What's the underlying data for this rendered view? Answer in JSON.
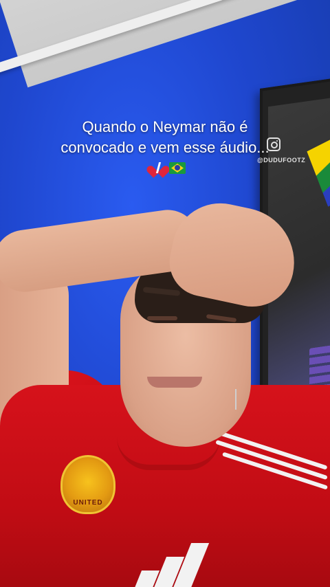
{
  "overlay": {
    "caption_line1": "Quando o Neymar não é",
    "caption_line2": "convocado e vem esse áudio...",
    "emojis": [
      "broken-heart-icon",
      "brazil-flag-icon"
    ]
  },
  "watermark": {
    "icon": "instagram-icon",
    "handle": "@DUDUFOOTZ"
  },
  "jersey": {
    "crest_text": "UNITED"
  },
  "colors": {
    "wall": "#1f47cf",
    "jersey_red": "#d6121b",
    "caption_text": "#ffffff"
  }
}
